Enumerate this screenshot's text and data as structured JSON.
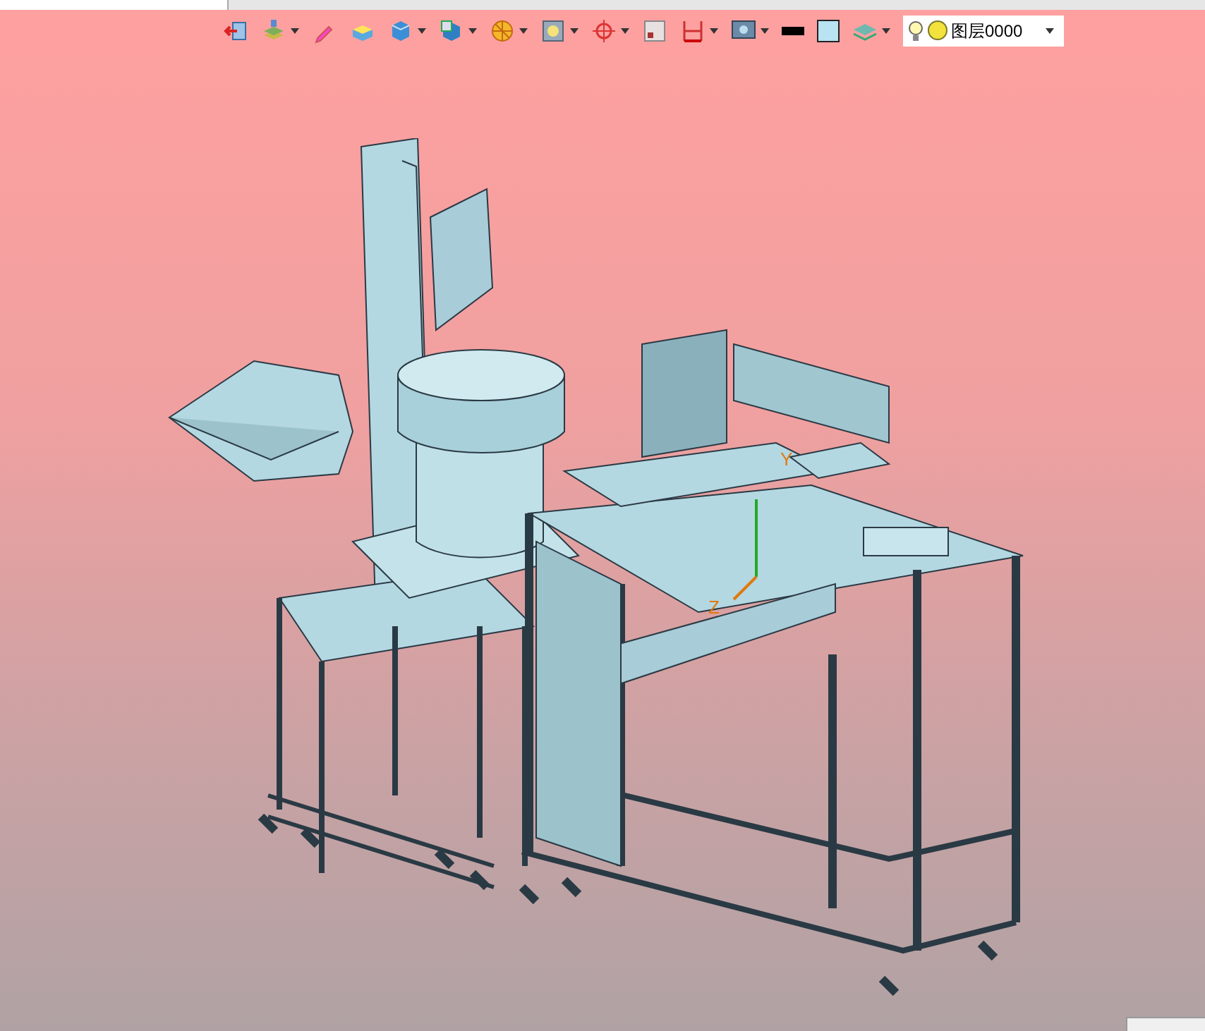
{
  "toolbar": {
    "layer_select": {
      "value": "图层0000"
    }
  },
  "viewport": {
    "axis_labels": [
      "Y",
      "Z"
    ]
  }
}
